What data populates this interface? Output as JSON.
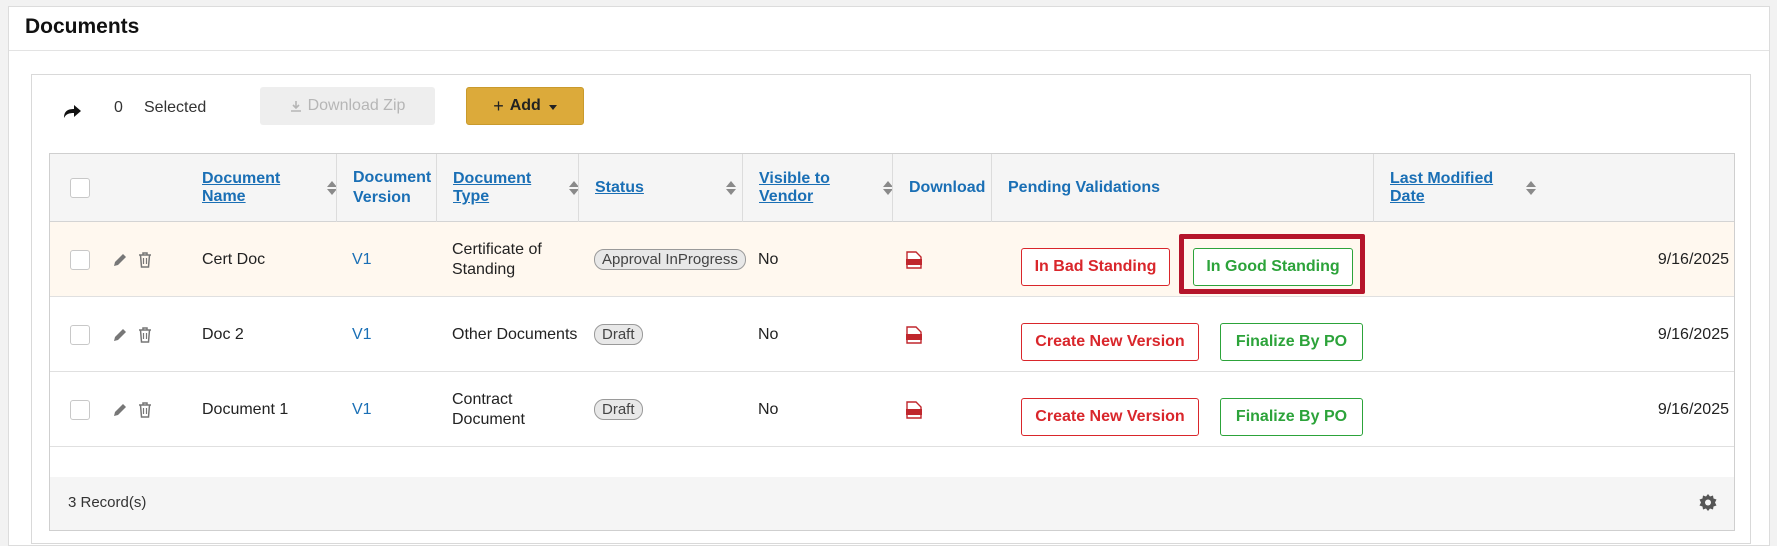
{
  "panel": {
    "title": "Documents"
  },
  "toolbar": {
    "selected_count": "0",
    "selected_label": "Selected",
    "download_zip_label": "Download Zip",
    "add_label": "Add"
  },
  "columns": {
    "document_name": "Document Name",
    "document_version_1": "Document",
    "document_version_2": "Version",
    "document_type": "Document Type",
    "status": "Status",
    "visible_to_vendor": "Visible to Vendor",
    "download": "Download",
    "pending_validations": "Pending Validations",
    "last_modified_date": "Last Modified Date"
  },
  "rows": [
    {
      "name": "Cert Doc",
      "version": "V1",
      "type_line1": "Certificate of",
      "type_line2": "Standing",
      "status": "Approval InProgress",
      "visible": "No",
      "action1": "In Bad Standing",
      "action2": "In Good Standing",
      "date": "9/16/2025"
    },
    {
      "name": "Doc 2",
      "version": "V1",
      "type_line1": "Other Documents",
      "type_line2": "",
      "status": "Draft",
      "visible": "No",
      "action1": "Create New Version",
      "action2": "Finalize By PO",
      "date": "9/16/2025"
    },
    {
      "name": "Document 1",
      "version": "V1",
      "type_line1": "Contract",
      "type_line2": "Document",
      "status": "Draft",
      "visible": "No",
      "action1": "Create New Version",
      "action2": "Finalize By PO",
      "date": "9/16/2025"
    }
  ],
  "footer": {
    "records": "3 Record(s)"
  },
  "icons": {
    "share": "share-arrow-icon",
    "download": "download-icon",
    "plus": "plus-icon",
    "edit": "pencil-icon",
    "delete": "trash-icon",
    "pdf": "pdf-icon",
    "settings": "gear-icon"
  },
  "colors": {
    "link": "#1a6fb5",
    "add_button": "#dcaa3a",
    "danger": "#d9262b",
    "success": "#2ca33a",
    "highlight_box": "#b5152b",
    "row_highlight": "#fff8ef"
  }
}
